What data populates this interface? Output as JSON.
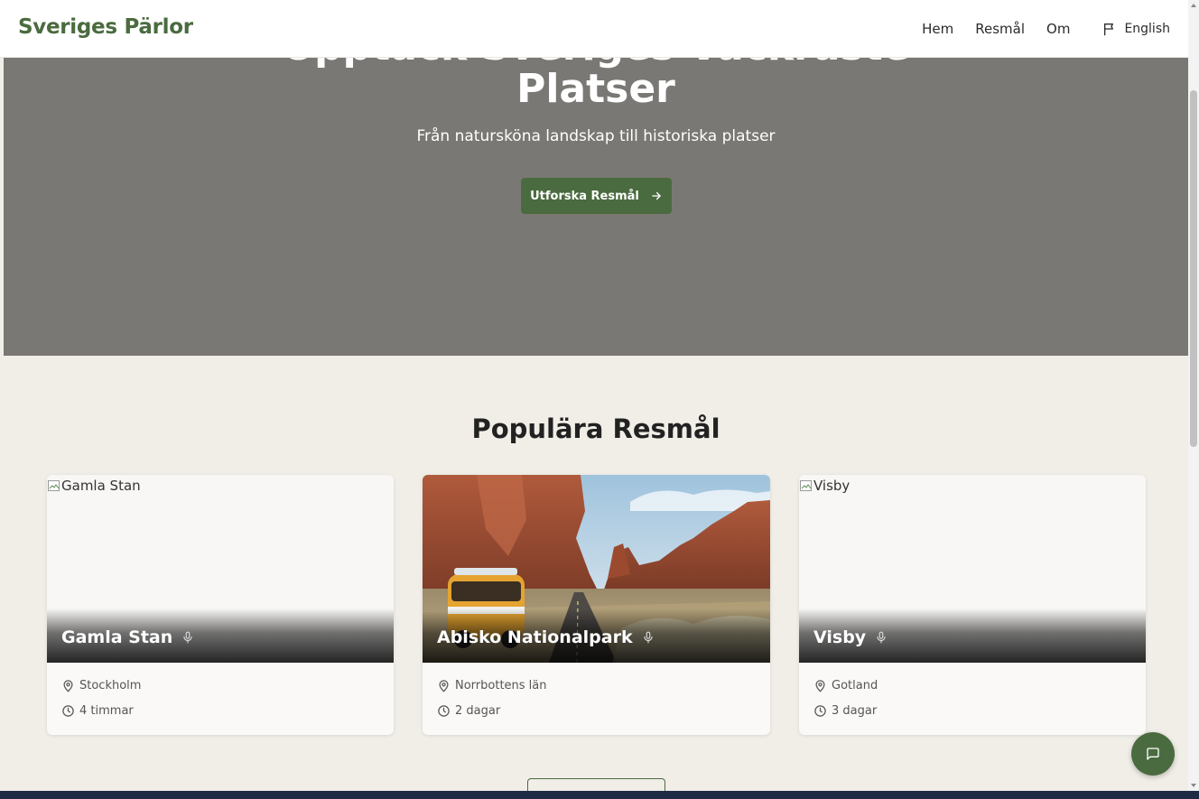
{
  "header": {
    "brand": "Sveriges Pärlor",
    "nav": [
      "Hem",
      "Resmål",
      "Om"
    ],
    "language": "English"
  },
  "hero": {
    "title_line1": "Upptäck Sveriges Vackraste",
    "title_line2": "Platser",
    "subtitle": "Från natursköna landskap till historiska platser",
    "cta": "Utforska Resmål"
  },
  "section": {
    "title": "Populära Resmål"
  },
  "cards": [
    {
      "alt": "Gamla Stan",
      "name": "Gamla Stan",
      "location": "Stockholm",
      "duration": "4 timmar",
      "image_loaded": false
    },
    {
      "alt": "Abisko Nationalpark",
      "name": "Abisko Nationalpark",
      "location": "Norrbottens län",
      "duration": "2 dagar",
      "image_loaded": true
    },
    {
      "alt": "Visby",
      "name": "Visby",
      "location": "Gotland",
      "duration": "3 dagar",
      "image_loaded": false
    }
  ],
  "colors": {
    "brand_green": "#4a6b3f",
    "hero_overlay": "#7a7874",
    "page_bg": "#f1eee8"
  },
  "icons": {
    "language": "flag-icon",
    "cta": "arrow-right-icon",
    "audio": "microphone-icon",
    "location": "map-pin-icon",
    "duration": "clock-icon",
    "chat": "message-square-icon"
  }
}
